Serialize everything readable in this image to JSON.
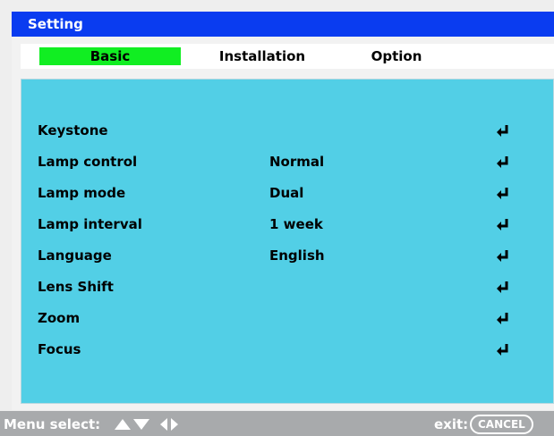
{
  "window": {
    "title": "Setting"
  },
  "tabs": [
    {
      "label": "Basic",
      "active": true
    },
    {
      "label": "Installation",
      "active": false
    },
    {
      "label": "Option",
      "active": false
    }
  ],
  "menu": {
    "items": [
      {
        "label": "Keystone",
        "value": ""
      },
      {
        "label": "Lamp control",
        "value": "Normal"
      },
      {
        "label": "Lamp mode",
        "value": "Dual"
      },
      {
        "label": "Lamp interval",
        "value": "1 week"
      },
      {
        "label": "Language",
        "value": "English"
      },
      {
        "label": "Lens Shift",
        "value": ""
      },
      {
        "label": "Zoom",
        "value": ""
      },
      {
        "label": "Focus",
        "value": ""
      }
    ],
    "enter_icon": "enter-return-icon"
  },
  "status": {
    "menu_select_label": "Menu select:",
    "arrows_icon": "arrow-keys-icon",
    "exit_label": "exit:",
    "cancel_key": "CANCEL"
  },
  "colors": {
    "title_bar": "#0a3cf0",
    "active_tab": "#11ee22",
    "content_bg": "#52cfe6",
    "status_bar": "#a8aaac"
  }
}
